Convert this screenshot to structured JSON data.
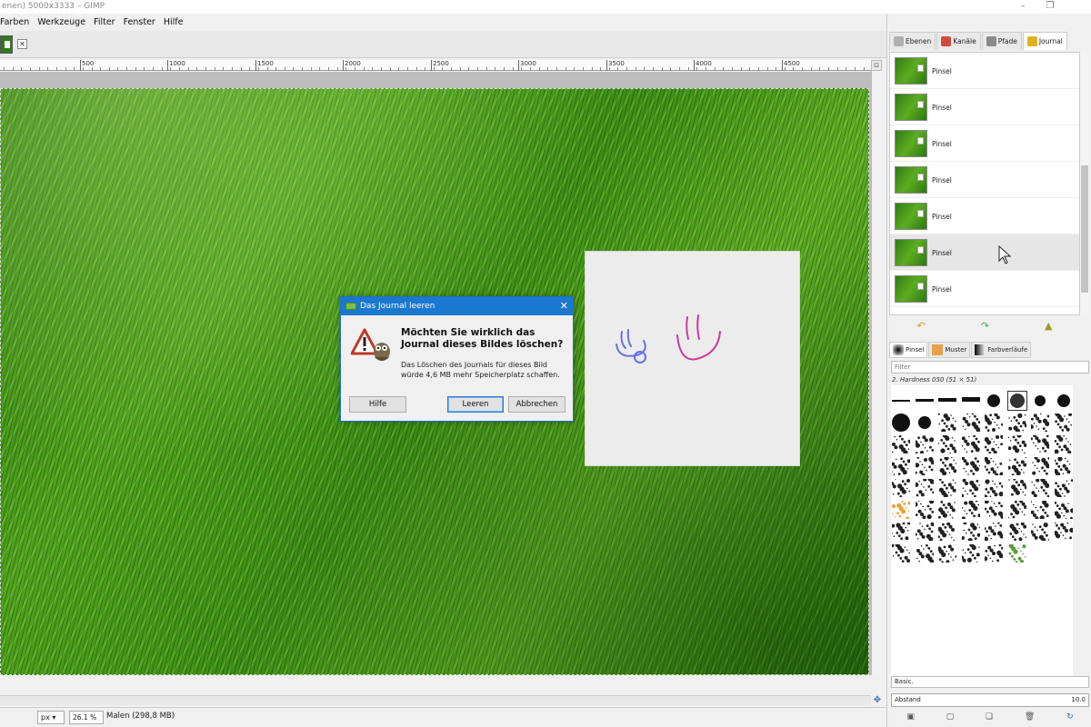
{
  "window": {
    "title": "enen) 5000x3333 – GIMP",
    "controls": [
      "–",
      "❐"
    ]
  },
  "menu": [
    "Farben",
    "Werkzeuge",
    "Filter",
    "Fenster",
    "Hilfe"
  ],
  "image_tab": {
    "close": "✕"
  },
  "ruler": {
    "labels": [
      "500",
      "1000",
      "1500",
      "2000",
      "2500",
      "3000",
      "3500",
      "4000",
      "4500"
    ]
  },
  "dialog": {
    "title": "Das Journal leeren",
    "close": "✕",
    "heading": "Möchten Sie wirklich das Journal dieses Bildes löschen?",
    "text": "Das Löschen des Journals für dieses Bild würde 4,6 MB mehr Speicherplatz schaffen.",
    "btn_help": "Hilfe",
    "btn_clear": "Leeren",
    "btn_cancel": "Abbrechen"
  },
  "status": {
    "unit": "px",
    "zoom": "26.1 %",
    "text": "Malen (298,8 MB)"
  },
  "dock": {
    "tabs": [
      {
        "label": "Ebenen",
        "color": "#b0b0b0"
      },
      {
        "label": "Kanäle",
        "color": "#d24a3a"
      },
      {
        "label": "Pfade",
        "color": "#8a8a8a"
      },
      {
        "label": "Journal",
        "color": "#e0b020"
      }
    ],
    "journal_items": [
      "Pinsel",
      "Pinsel",
      "Pinsel",
      "Pinsel",
      "Pinsel",
      "Pinsel",
      "Pinsel"
    ],
    "selected_index": 5,
    "brush_tabs": [
      "Pinsel",
      "Muster",
      "Farbverläufe"
    ],
    "filter_placeholder": "Filter",
    "brush_name": "2. Hardness 050 (51 × 51)",
    "preset": "Basic.",
    "spacing_label": "Abstand",
    "spacing_value": "10.0"
  },
  "colors": {
    "dialog_title": "#1b78d0",
    "sketch_blue": "#6b6ee8",
    "sketch_pink": "#cc3a9a"
  }
}
